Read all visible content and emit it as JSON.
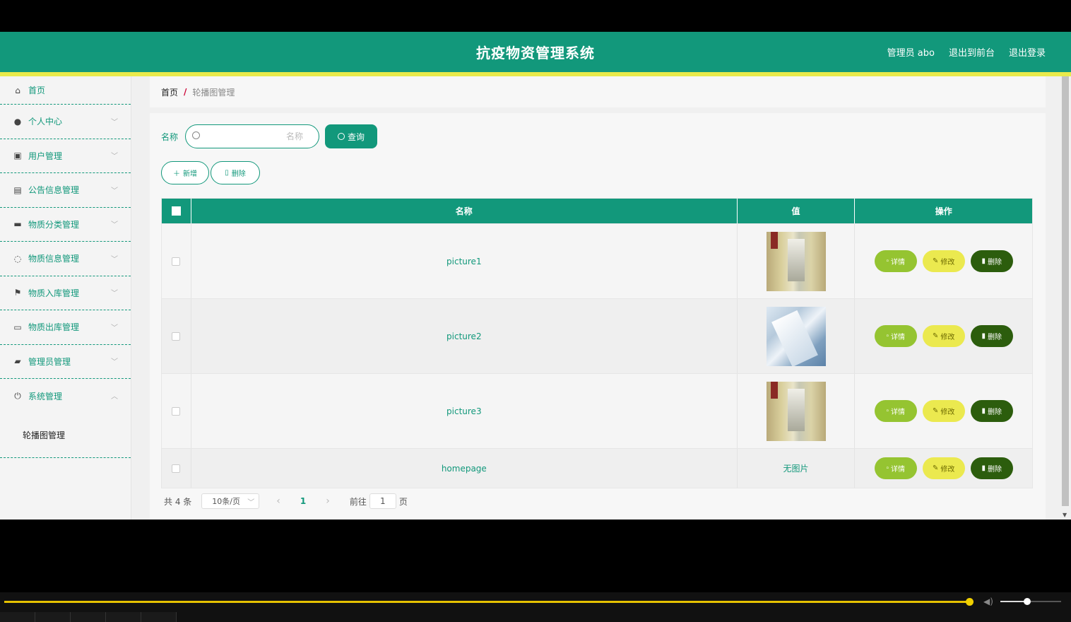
{
  "header": {
    "title": "抗疫物资管理系统",
    "admin_label": "管理员 abo",
    "to_front": "退出到前台",
    "logout": "退出登录",
    "color": "#12987b",
    "accent_bar": "#e9ea4b"
  },
  "sidebar": {
    "items": [
      {
        "label": "首页",
        "icon": "home-icon"
      },
      {
        "label": "个人中心",
        "icon": "user-icon"
      },
      {
        "label": "用户管理",
        "icon": "chart-icon"
      },
      {
        "label": "公告信息管理",
        "icon": "clipboard-icon"
      },
      {
        "label": "物质分类管理",
        "icon": "briefcase-icon"
      },
      {
        "label": "物质信息管理",
        "icon": "globe-icon"
      },
      {
        "label": "物质入库管理",
        "icon": "flag-icon"
      },
      {
        "label": "物质出库管理",
        "icon": "chat-icon"
      },
      {
        "label": "管理员管理",
        "icon": "wallet-icon"
      },
      {
        "label": "系统管理",
        "icon": "power-icon"
      }
    ],
    "submenu": "轮播图管理"
  },
  "breadcrumb": {
    "home": "首页",
    "separator": "/",
    "current": "轮播图管理"
  },
  "search": {
    "label": "名称",
    "placeholder": "名称",
    "button": "查询"
  },
  "actions": {
    "add": "新增",
    "delete": "删除"
  },
  "table": {
    "headers": [
      "名称",
      "值",
      "操作"
    ],
    "rows": [
      {
        "name": "picture1",
        "value_image": "hallway"
      },
      {
        "name": "picture2",
        "value_image": "medical"
      },
      {
        "name": "picture3",
        "value_image": "hallway"
      },
      {
        "name": "homepage",
        "value_text": "无图片"
      }
    ],
    "ops": {
      "detail": "详情",
      "edit": "修改",
      "remove": "删除"
    }
  },
  "pager": {
    "total": "共 4 条",
    "page_size": "10条/页",
    "current_page": "1",
    "goto_label": "前往",
    "goto_value": "1",
    "page_suffix": "页"
  },
  "video": {
    "progress": 0.905,
    "volume": 0.44
  }
}
